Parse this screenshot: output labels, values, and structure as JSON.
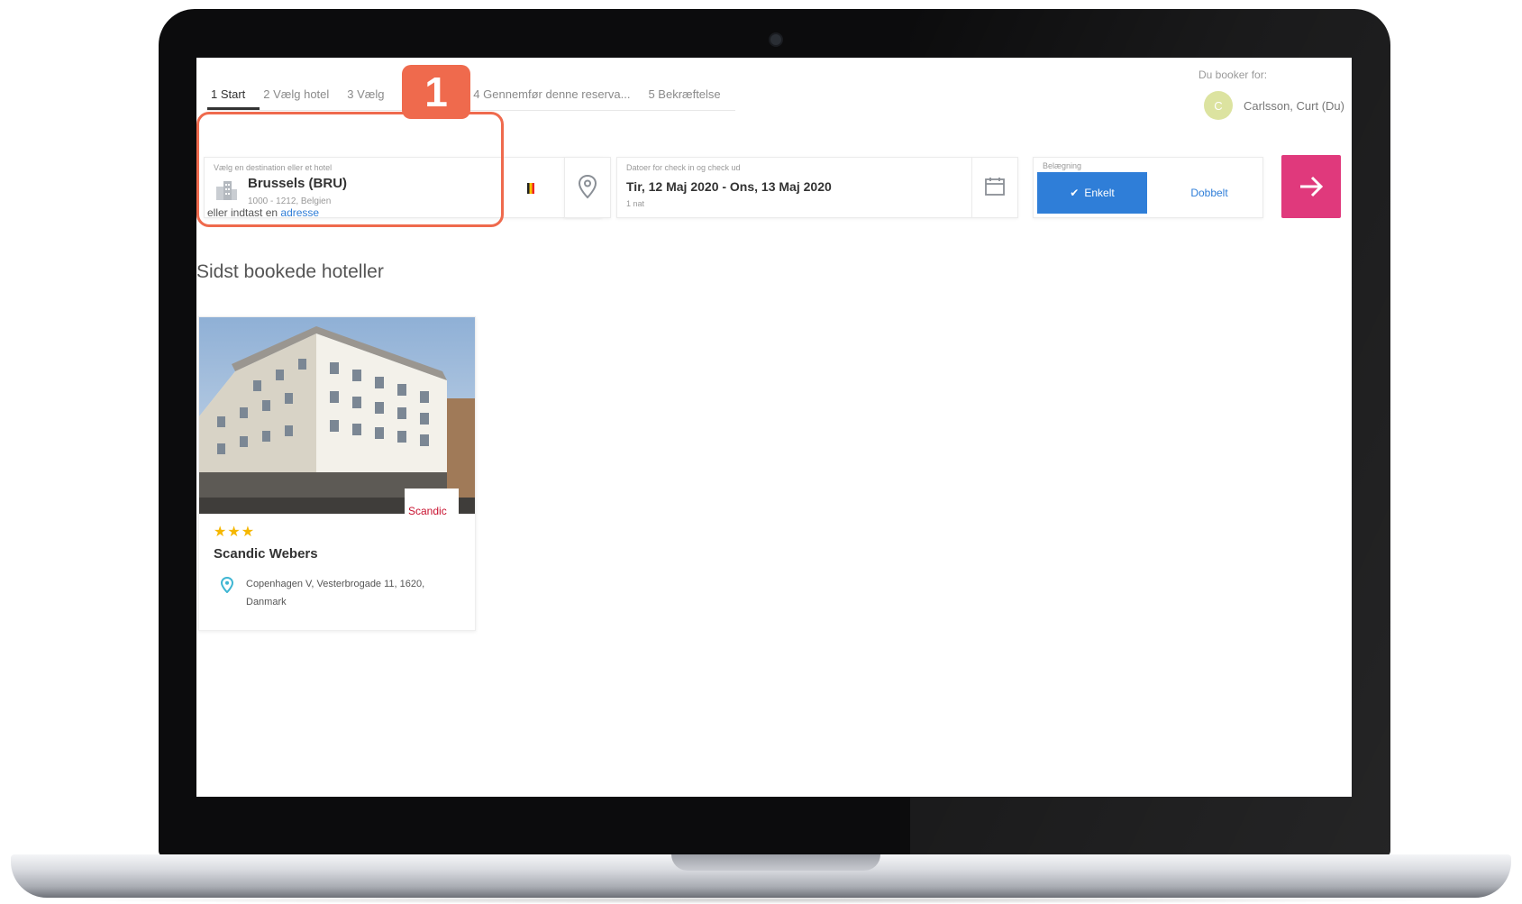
{
  "steps": [
    {
      "label": "1  Start"
    },
    {
      "label": "2  Vælg hotel"
    },
    {
      "label": "3  Vælg"
    },
    {
      "label": "4  Gennemfør denne reserva..."
    },
    {
      "label": "5  Bekræftelse"
    }
  ],
  "booker": {
    "label": "Du booker for:",
    "initial": "C",
    "name": "Carlsson, Curt (Du)"
  },
  "destination": {
    "label": "Vælg en destination eller et hotel",
    "value": "Brussels (BRU)",
    "sub": "1000 - 1212, Belgien",
    "address_prefix": "eller indtast en ",
    "address_link": "adresse"
  },
  "callout": {
    "number": "1",
    "color": "#ef6a4d"
  },
  "dates": {
    "label": "Datoer for check in og check ud",
    "value": "Tir, 12 Maj 2020 -   Ons, 13 Maj 2020",
    "sub": "1 nat"
  },
  "rooms": {
    "label": "Belægning",
    "single": "Enkelt",
    "double": "Dobbelt"
  },
  "recent": {
    "title": "Sidst bookede hoteller",
    "hotels": [
      {
        "name": "Scandic Webers",
        "stars": "★★★",
        "brand": "Scandic",
        "address": "Copenhagen V, Vesterbrogade 11, 1620, Danmark"
      }
    ]
  },
  "colors": {
    "accent_blue": "#2f7ed8",
    "go_button": "#e0397c",
    "star": "#f5b700",
    "brand_red": "#c8102e"
  }
}
